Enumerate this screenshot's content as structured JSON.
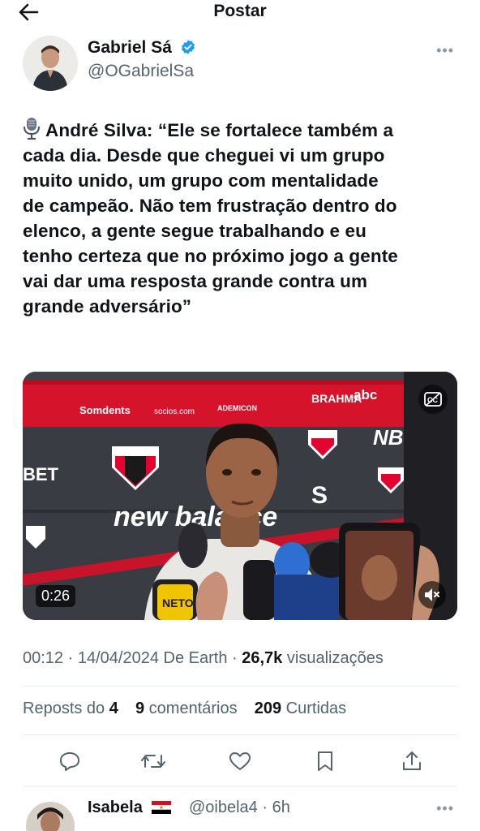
{
  "header": {
    "title": "Postar"
  },
  "author": {
    "name": "Gabriel Sá",
    "handle": "@OGabrielSa"
  },
  "tweet": {
    "text": "André Silva: “Ele se fortalece também a cada dia. Desde que cheguei vi um grupo muito unido, um grupo com mentalidade de campeão. Não tem frustração dentro do elenco, a gente segue trabalhando e eu tenho certeza que no próximo jogo a gente vai dar uma resposta grande contra um grande adversário”",
    "lines": [
      "André Silva: “Ele se fortalece também a",
      "cada dia. Desde que cheguei vi um grupo",
      "muito unido, um grupo com mentalidade",
      "de campeão. Não tem frustração dentro do",
      "elenco, a gente segue trabalhando e eu",
      "tenho certeza que no próximo jogo a gente",
      "vai dar uma resposta grande contra um",
      "grande adversário”"
    ]
  },
  "media": {
    "duration": "0:26",
    "backdrop_texts": [
      "Somdents",
      "socios.com",
      "ADEMICON",
      "BRAHMA",
      "abc",
      "new balance",
      "BET",
      "S"
    ],
    "mic_texts": [
      "NETO"
    ]
  },
  "meta": {
    "time": "00:12",
    "date": "14/04/2024",
    "from_label": "De",
    "location": "Earth",
    "views_count": "26,7k",
    "views_label": "visualizações"
  },
  "stats": {
    "reposts_label": "Reposts do",
    "reposts_count": "4",
    "comments_count": "9",
    "comments_label": "comentários",
    "likes_count": "209",
    "likes_label": "Curtidas"
  },
  "reply": {
    "name": "Isabela",
    "handle": "@oibela4 · 6h"
  },
  "colors": {
    "accent": "#1d9bf0",
    "muted": "#536471",
    "text": "#0f1419",
    "spfc_red": "#e4032e"
  },
  "icons": [
    "back-arrow-icon",
    "verified-badge-icon",
    "more-icon",
    "microphone-icon",
    "cc-icon",
    "mute-icon",
    "reply-icon",
    "repost-icon",
    "like-icon",
    "bookmark-icon",
    "share-icon",
    "egypt-flag-icon"
  ]
}
